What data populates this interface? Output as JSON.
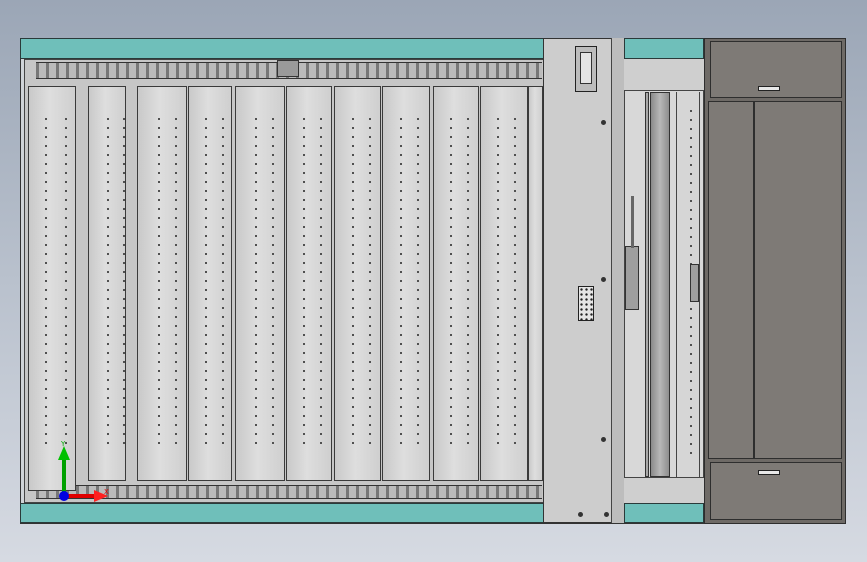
{
  "colors": {
    "background_top": "#9ba6b6",
    "background_bottom": "#d6dae2",
    "frame_teal": "#6fbfba",
    "panel_grey": "#d4d4d4",
    "door_grey": "#7e7a76",
    "axis_x": "#e00000",
    "axis_y": "#00a000",
    "axis_z": "#0000e0"
  },
  "triad": {
    "y_label": "Y",
    "x_label": "X"
  },
  "icons": [
    "coordinate-triad-icon",
    "screw-icon",
    "keypad-icon",
    "handle-icon"
  ]
}
